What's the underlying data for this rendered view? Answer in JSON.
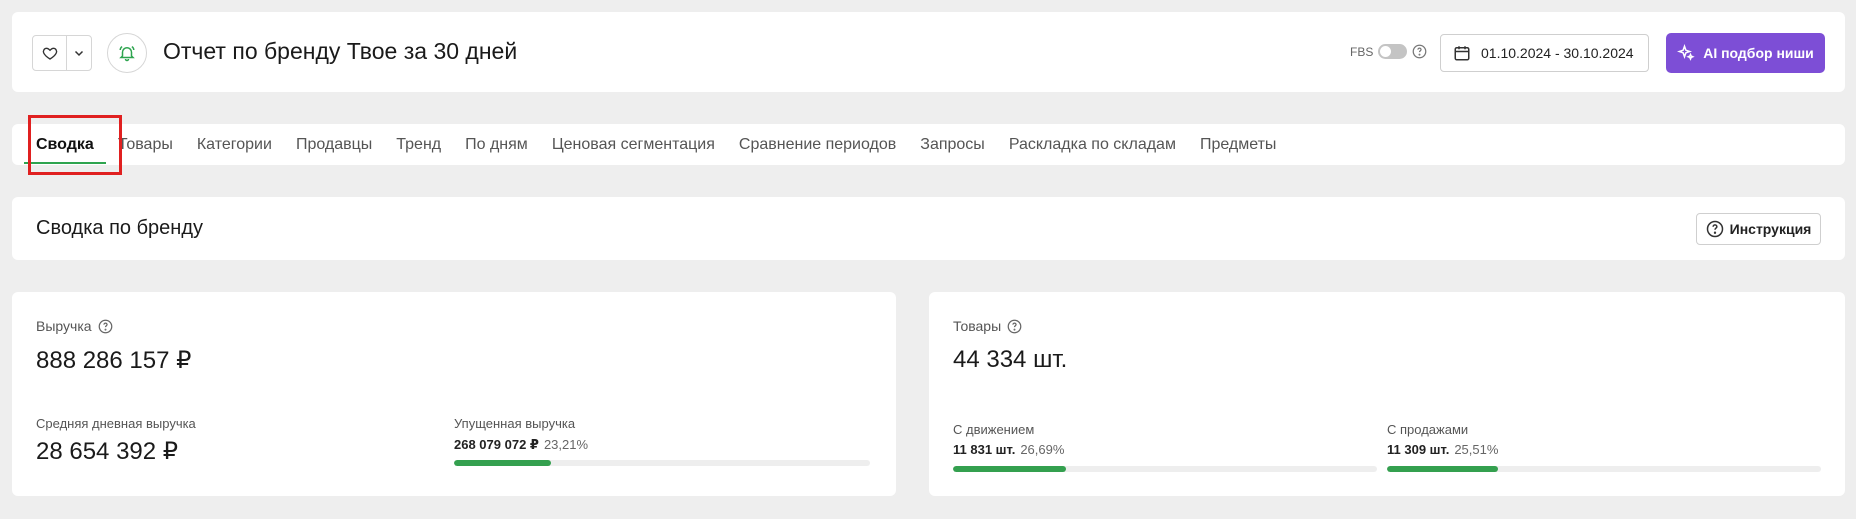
{
  "header": {
    "title": "Отчет по бренду Твое за 30 дней",
    "fbs_label": "FBS",
    "date_range": "01.10.2024 - 30.10.2024",
    "ai_button": "AI подбор ниши",
    "accent_color": "#7d4ed6"
  },
  "tabs": [
    {
      "label": "Сводка",
      "active": true
    },
    {
      "label": "Товары"
    },
    {
      "label": "Категории"
    },
    {
      "label": "Продавцы"
    },
    {
      "label": "Тренд"
    },
    {
      "label": "По дням"
    },
    {
      "label": "Ценовая сегментация"
    },
    {
      "label": "Сравнение периодов"
    },
    {
      "label": "Запросы"
    },
    {
      "label": "Раскладка по складам"
    },
    {
      "label": "Предметы"
    }
  ],
  "section": {
    "title": "Сводка по бренду",
    "instruction_button": "Инструкция"
  },
  "revenue": {
    "label": "Выручка",
    "value": "888 286 157 ₽",
    "avg_label": "Средняя дневная выручка",
    "avg_value": "28 654 392 ₽",
    "lost_label": "Упущенная выручка",
    "lost_value": "268 079 072 ₽",
    "lost_percent": "23,21%",
    "lost_fraction": 0.2321
  },
  "goods": {
    "label": "Товары",
    "value": "44 334 шт.",
    "movement_label": "С движением",
    "movement_value": "11 831 шт.",
    "movement_percent": "26,69%",
    "movement_fraction": 0.2669,
    "sales_label": "С продажами",
    "sales_value": "11 309 шт.",
    "sales_percent": "25,51%",
    "sales_fraction": 0.2551
  }
}
